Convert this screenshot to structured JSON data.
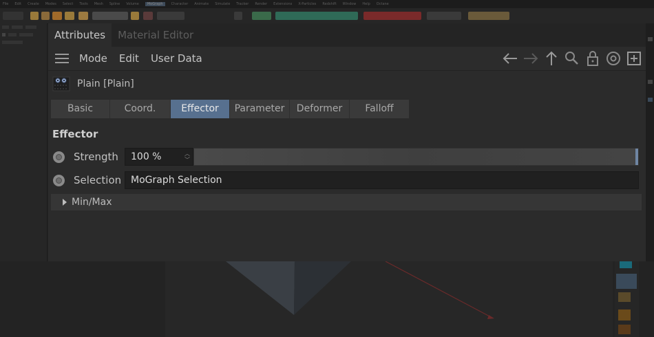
{
  "app": {
    "menubar": [
      "File",
      "Edit",
      "Create",
      "Modes",
      "Select",
      "Tools",
      "Mesh",
      "Spline",
      "Volume",
      "MoGraph",
      "Character",
      "Animate",
      "Simulate",
      "Tracker",
      "Render",
      "Extensions",
      "X-Particles",
      "Redshift",
      "Window",
      "Help",
      "Octane"
    ],
    "menubar_active": "MoGraph"
  },
  "panel_tabs": [
    {
      "label": "Attributes",
      "active": true
    },
    {
      "label": "Material Editor",
      "active": false
    }
  ],
  "menu": {
    "items": [
      "Mode",
      "Edit",
      "User Data"
    ]
  },
  "nav_icons": [
    "arrow-left-icon",
    "arrow-right-icon",
    "arrow-up-icon",
    "search-icon",
    "lock-icon",
    "target-icon",
    "new-panel-icon"
  ],
  "object": {
    "label": "Plain [Plain]",
    "icon": "plain-effector-icon"
  },
  "subtabs": [
    {
      "label": "Basic",
      "active": false
    },
    {
      "label": "Coord.",
      "active": false
    },
    {
      "label": "Effector",
      "active": true
    },
    {
      "label": "Parameter",
      "active": false
    },
    {
      "label": "Deformer",
      "active": false
    },
    {
      "label": "Falloff",
      "active": false
    }
  ],
  "section": {
    "title": "Effector"
  },
  "params": {
    "strength": {
      "label": "Strength",
      "value": "100 %",
      "fraction": 1.0
    },
    "selection": {
      "label": "Selection",
      "value": "MoGraph Selection"
    }
  },
  "group": {
    "label": "Min/Max",
    "expanded": false
  },
  "colors": {
    "active_tab": "#57708f",
    "slider_thumb": "#6f86a3",
    "panel_bg": "#2b2b2b"
  }
}
